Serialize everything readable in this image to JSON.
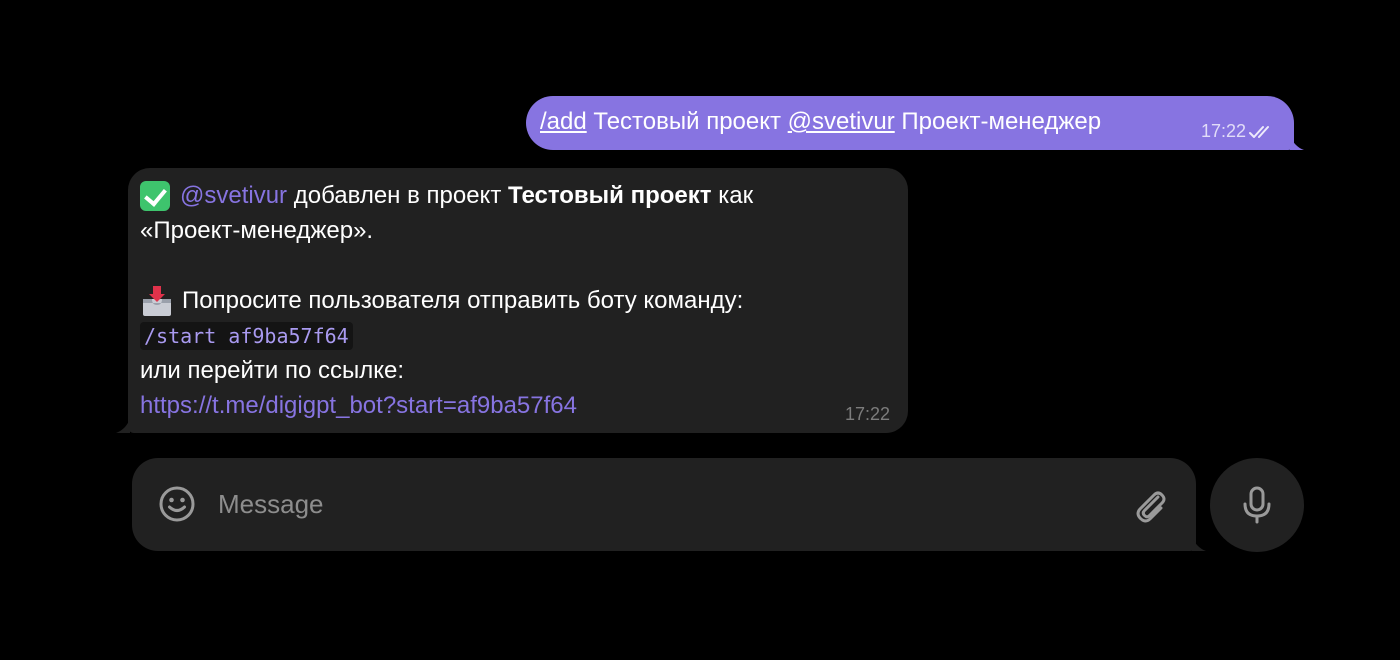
{
  "outgoing_message": {
    "command": "/add",
    "text_middle": " Тестовый проект ",
    "mention": "@svetivur",
    "text_end": " Проект-менеджер",
    "time": "17:22",
    "status_icon": "double-check-icon"
  },
  "incoming_message": {
    "line1": {
      "icon": "check-mark-emoji",
      "mention": "@svetivur",
      "text_a": " добавлен в проект ",
      "bold": "Тестовый проект",
      "text_b": " как"
    },
    "line2": "«Проект-менеджер».",
    "line3": {
      "icon": "inbox-tray-emoji",
      "text": "Попросите пользователя отправить боту команду:"
    },
    "code": "/start af9ba57f64",
    "line5": "или перейти по ссылке:",
    "url": "https://t.me/digigpt_bot?start=af9ba57f64",
    "time": "17:22"
  },
  "composer": {
    "placeholder": "Message",
    "emoji_icon": "smile-icon",
    "attach_icon": "paperclip-icon",
    "mic_icon": "microphone-icon"
  },
  "colors": {
    "background": "#000000",
    "outgoing_bubble": "#8774e1",
    "incoming_bubble": "#212121",
    "accent": "#8774e1",
    "code_text": "#a99af0",
    "timestamp_muted": "#7c7c7c"
  }
}
